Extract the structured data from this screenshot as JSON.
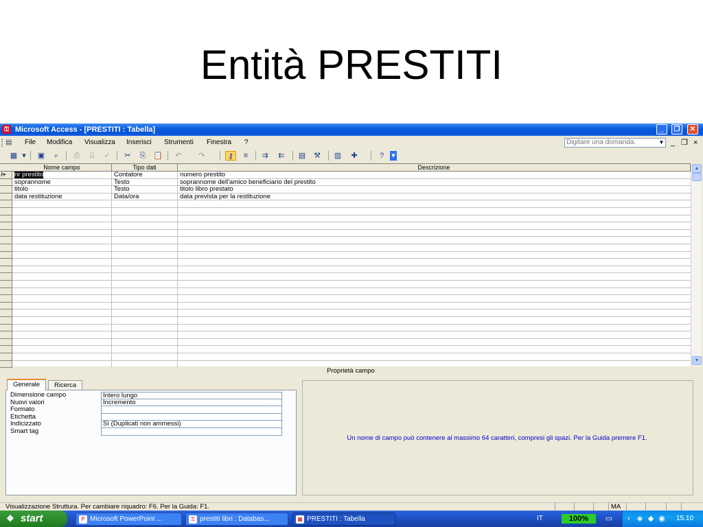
{
  "slide": {
    "title": "Entità PRESTITI"
  },
  "window": {
    "title": "Microsoft Access - [PRESTITI : Tabella]"
  },
  "menu": {
    "items": [
      "File",
      "Modifica",
      "Visualizza",
      "Inserisci",
      "Strumenti",
      "Finestra",
      "?"
    ],
    "ask_placeholder": "Digitare una domanda."
  },
  "grid": {
    "columns": [
      "Nome campo",
      "Tipo dati",
      "Descrizione"
    ],
    "rows": [
      {
        "name": "nr prestito",
        "type": "Contatore",
        "description": "numero prestito"
      },
      {
        "name": "soprannome",
        "type": "Testo",
        "description": "soprannome dell'amico beneficiario del prestito"
      },
      {
        "name": "titolo",
        "type": "Testo",
        "description": "titolo libro prestato"
      },
      {
        "name": "data restituzione",
        "type": "Data/ora",
        "description": "data prevista per la restituzione"
      }
    ]
  },
  "properties": {
    "header": "Proprietà campo",
    "tabs": [
      "Generale",
      "Ricerca"
    ],
    "rows": [
      {
        "label": "Dimensione campo",
        "value": "Intero lungo"
      },
      {
        "label": "Nuovi valori",
        "value": "Incremento"
      },
      {
        "label": "Formato",
        "value": ""
      },
      {
        "label": "Etichetta",
        "value": ""
      },
      {
        "label": "Indicizzato",
        "value": "Sì (Duplicati non ammessi)"
      },
      {
        "label": "Smart tag",
        "value": ""
      }
    ],
    "help": "Un nome di campo può contenere al massimo 64 caratteri, compresi gli spazi. Per la Guida premere F1."
  },
  "status": {
    "text": "Visualizzazione Struttura. Per cambiare riquadro: F6. Per la Guida: F1.",
    "indicator": "MA"
  },
  "taskbar": {
    "start": "start",
    "tasks": [
      "Microsoft PowerPoint ...",
      "prestiti libri : Databas...",
      "PRESTITI : Tabella"
    ],
    "language": "IT",
    "zoom": "100%",
    "clock": "15.10"
  }
}
